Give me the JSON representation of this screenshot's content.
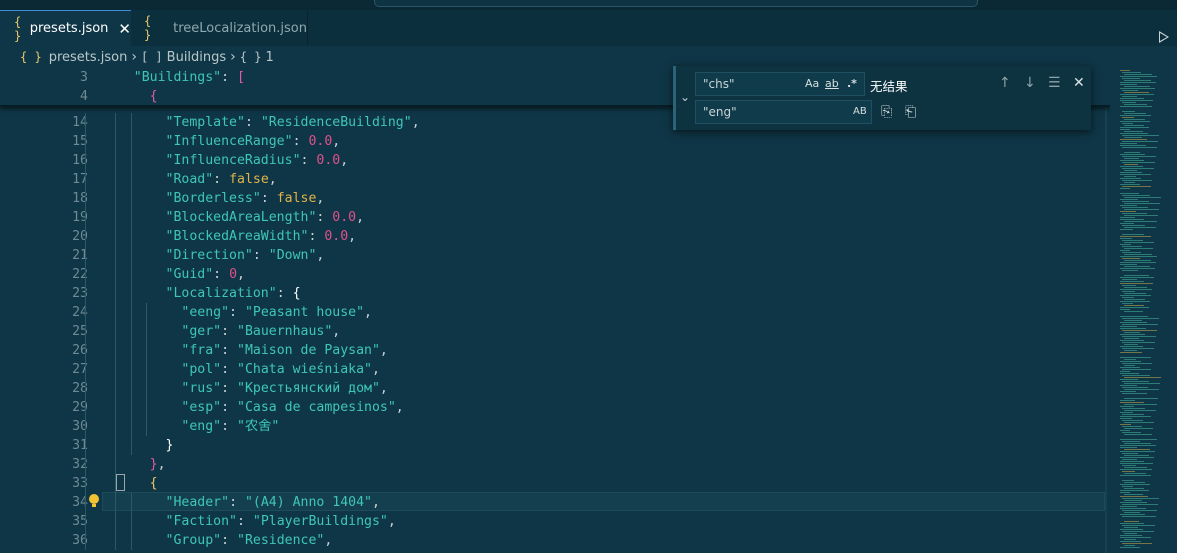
{
  "tabs": [
    {
      "label": "presets.json",
      "icon": "{ }",
      "active": true,
      "close": "✕"
    },
    {
      "label": "treeLocalization.json",
      "icon": "{ }",
      "active": false
    }
  ],
  "breadcrumb": {
    "file": "presets.json",
    "icon": "{ }",
    "seg1_icon": "[ ]",
    "seg1": "Buildings",
    "seg2_icon": "{ }",
    "seg2": "1"
  },
  "find": {
    "find_value": "\"chs\"",
    "replace_value": "\"eng\"",
    "match_case": "Aa",
    "whole_word": "ab",
    "regex": ".*",
    "preserve_case": "AB",
    "result": "无结果"
  },
  "code": {
    "sticky": [
      {
        "n": "3",
        "tokens": [
          [
            "    ",
            "p"
          ],
          [
            "\"Buildings\"",
            "k"
          ],
          [
            ": ",
            "p"
          ],
          [
            "[",
            "br1"
          ]
        ]
      },
      {
        "n": "4",
        "tokens": [
          [
            "      ",
            "p"
          ],
          [
            "{",
            "br1"
          ]
        ]
      }
    ],
    "lines": [
      {
        "n": "14",
        "tokens": [
          [
            "        ",
            "p"
          ],
          [
            "\"Template\"",
            "k"
          ],
          [
            ": ",
            "p"
          ],
          [
            "\"ResidenceBuilding\"",
            "s"
          ],
          [
            ",",
            "p"
          ]
        ]
      },
      {
        "n": "15",
        "tokens": [
          [
            "        ",
            "p"
          ],
          [
            "\"InfluenceRange\"",
            "k"
          ],
          [
            ": ",
            "p"
          ],
          [
            "0.0",
            "n"
          ],
          [
            ",",
            "p"
          ]
        ]
      },
      {
        "n": "16",
        "tokens": [
          [
            "        ",
            "p"
          ],
          [
            "\"InfluenceRadius\"",
            "k"
          ],
          [
            ": ",
            "p"
          ],
          [
            "0.0",
            "n"
          ],
          [
            ",",
            "p"
          ]
        ]
      },
      {
        "n": "17",
        "tokens": [
          [
            "        ",
            "p"
          ],
          [
            "\"Road\"",
            "k"
          ],
          [
            ": ",
            "p"
          ],
          [
            "false",
            "b"
          ],
          [
            ",",
            "p"
          ]
        ]
      },
      {
        "n": "18",
        "tokens": [
          [
            "        ",
            "p"
          ],
          [
            "\"Borderless\"",
            "k"
          ],
          [
            ": ",
            "p"
          ],
          [
            "false",
            "b"
          ],
          [
            ",",
            "p"
          ]
        ]
      },
      {
        "n": "19",
        "tokens": [
          [
            "        ",
            "p"
          ],
          [
            "\"BlockedAreaLength\"",
            "k"
          ],
          [
            ": ",
            "p"
          ],
          [
            "0.0",
            "n"
          ],
          [
            ",",
            "p"
          ]
        ]
      },
      {
        "n": "20",
        "tokens": [
          [
            "        ",
            "p"
          ],
          [
            "\"BlockedAreaWidth\"",
            "k"
          ],
          [
            ": ",
            "p"
          ],
          [
            "0.0",
            "n"
          ],
          [
            ",",
            "p"
          ]
        ]
      },
      {
        "n": "21",
        "tokens": [
          [
            "        ",
            "p"
          ],
          [
            "\"Direction\"",
            "k"
          ],
          [
            ": ",
            "p"
          ],
          [
            "\"Down\"",
            "s"
          ],
          [
            ",",
            "p"
          ]
        ]
      },
      {
        "n": "22",
        "tokens": [
          [
            "        ",
            "p"
          ],
          [
            "\"Guid\"",
            "k"
          ],
          [
            ": ",
            "p"
          ],
          [
            "0",
            "n"
          ],
          [
            ",",
            "p"
          ]
        ]
      },
      {
        "n": "23",
        "tokens": [
          [
            "        ",
            "p"
          ],
          [
            "\"Localization\"",
            "k"
          ],
          [
            ": ",
            "p"
          ],
          [
            "{",
            "br3"
          ]
        ]
      },
      {
        "n": "24",
        "tokens": [
          [
            "          ",
            "p"
          ],
          [
            "\"eeng\"",
            "k"
          ],
          [
            ": ",
            "p"
          ],
          [
            "\"Peasant house\"",
            "s"
          ],
          [
            ",",
            "p"
          ]
        ]
      },
      {
        "n": "25",
        "tokens": [
          [
            "          ",
            "p"
          ],
          [
            "\"ger\"",
            "k"
          ],
          [
            ": ",
            "p"
          ],
          [
            "\"Bauernhaus\"",
            "s"
          ],
          [
            ",",
            "p"
          ]
        ]
      },
      {
        "n": "26",
        "tokens": [
          [
            "          ",
            "p"
          ],
          [
            "\"fra\"",
            "k"
          ],
          [
            ": ",
            "p"
          ],
          [
            "\"Maison de Paysan\"",
            "s"
          ],
          [
            ",",
            "p"
          ]
        ]
      },
      {
        "n": "27",
        "tokens": [
          [
            "          ",
            "p"
          ],
          [
            "\"pol\"",
            "k"
          ],
          [
            ": ",
            "p"
          ],
          [
            "\"Chata wieśniaka\"",
            "s"
          ],
          [
            ",",
            "p"
          ]
        ]
      },
      {
        "n": "28",
        "tokens": [
          [
            "          ",
            "p"
          ],
          [
            "\"rus\"",
            "k"
          ],
          [
            ": ",
            "p"
          ],
          [
            "\"Крестьянский дом\"",
            "s"
          ],
          [
            ",",
            "p"
          ]
        ]
      },
      {
        "n": "29",
        "tokens": [
          [
            "          ",
            "p"
          ],
          [
            "\"esp\"",
            "k"
          ],
          [
            ": ",
            "p"
          ],
          [
            "\"Casa de campesinos\"",
            "s"
          ],
          [
            ",",
            "p"
          ]
        ]
      },
      {
        "n": "30",
        "tokens": [
          [
            "          ",
            "p"
          ],
          [
            "\"eng\"",
            "k"
          ],
          [
            ": ",
            "p"
          ],
          [
            "\"农舍\"",
            "s"
          ]
        ]
      },
      {
        "n": "31",
        "tokens": [
          [
            "        ",
            "p"
          ],
          [
            "}",
            "br3"
          ]
        ]
      },
      {
        "n": "32",
        "tokens": [
          [
            "      ",
            "p"
          ],
          [
            "}",
            "br1"
          ],
          [
            ",",
            "p"
          ]
        ]
      },
      {
        "n": "33",
        "tokens": [
          [
            "      ",
            "p"
          ],
          [
            "{",
            "br2"
          ]
        ]
      },
      {
        "n": "34",
        "tokens": [
          [
            "        ",
            "p"
          ],
          [
            "\"Header\"",
            "k"
          ],
          [
            ": ",
            "p"
          ],
          [
            "\"(A4) Anno 1404\"",
            "s"
          ],
          [
            ",",
            "p"
          ]
        ]
      },
      {
        "n": "35",
        "tokens": [
          [
            "        ",
            "p"
          ],
          [
            "\"Faction\"",
            "k"
          ],
          [
            ": ",
            "p"
          ],
          [
            "\"PlayerBuildings\"",
            "s"
          ],
          [
            ",",
            "p"
          ]
        ]
      },
      {
        "n": "36",
        "tokens": [
          [
            "        ",
            "p"
          ],
          [
            "\"Group\"",
            "k"
          ],
          [
            ": ",
            "p"
          ],
          [
            "\"Residence\"",
            "s"
          ],
          [
            ",",
            "p"
          ]
        ]
      }
    ]
  }
}
